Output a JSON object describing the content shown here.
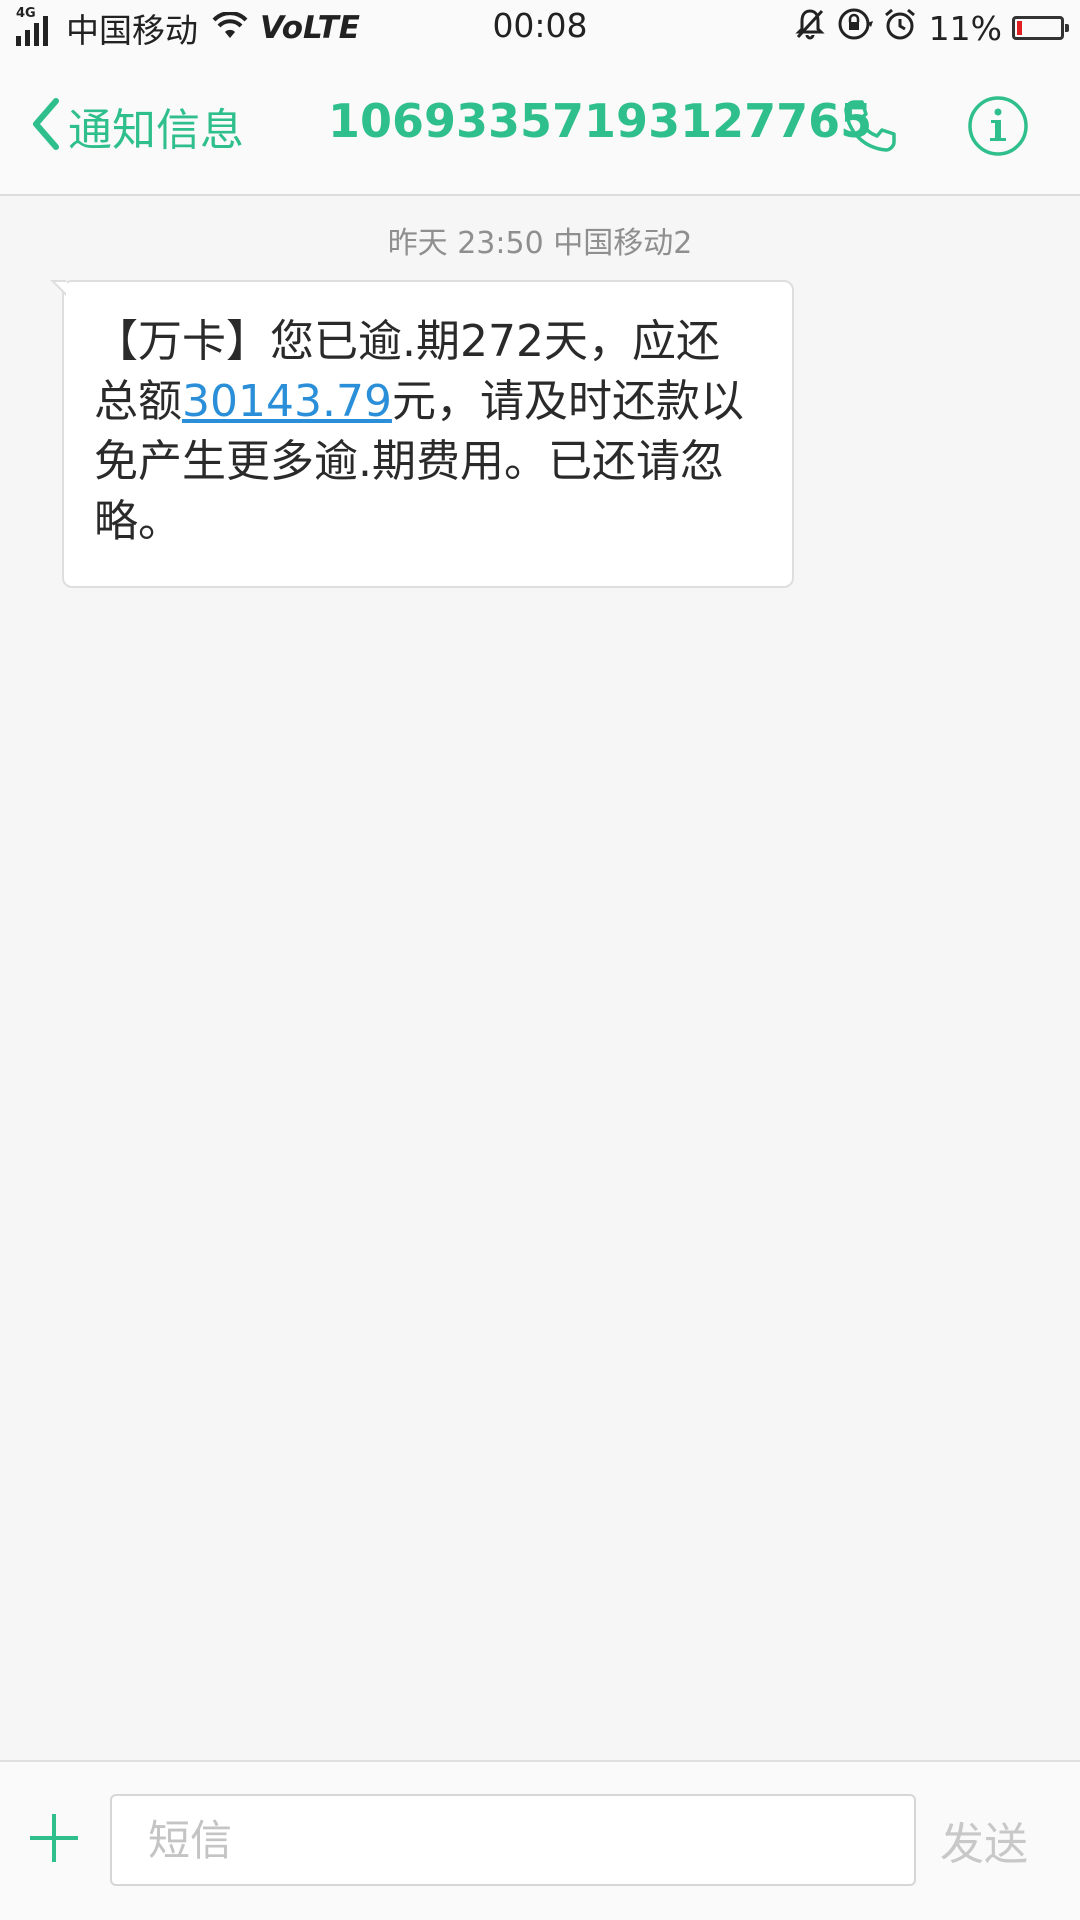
{
  "status_bar": {
    "network_type": "4G",
    "carrier": "中国移动",
    "volte": "VoLTE",
    "time": "00:08",
    "battery_percent": "11%",
    "battery_level": 0.11,
    "icons": [
      "signal-icon",
      "wifi-icon",
      "mute-icon",
      "rotation-lock-icon",
      "alarm-icon",
      "battery-icon"
    ]
  },
  "header": {
    "back_label": "通知信息",
    "contact_number": "10693357193127765",
    "accent_color": "#2fbf8c"
  },
  "message": {
    "meta": "昨天 23:50  中国移动2",
    "text_before": "【万卡】您已逾.期272天，应还总额",
    "amount_link": "30143.79",
    "text_after": "元，请及时还款以免产生更多逾.期费用。已还请忽略。"
  },
  "input_bar": {
    "placeholder": "短信",
    "send_label": "发送"
  }
}
